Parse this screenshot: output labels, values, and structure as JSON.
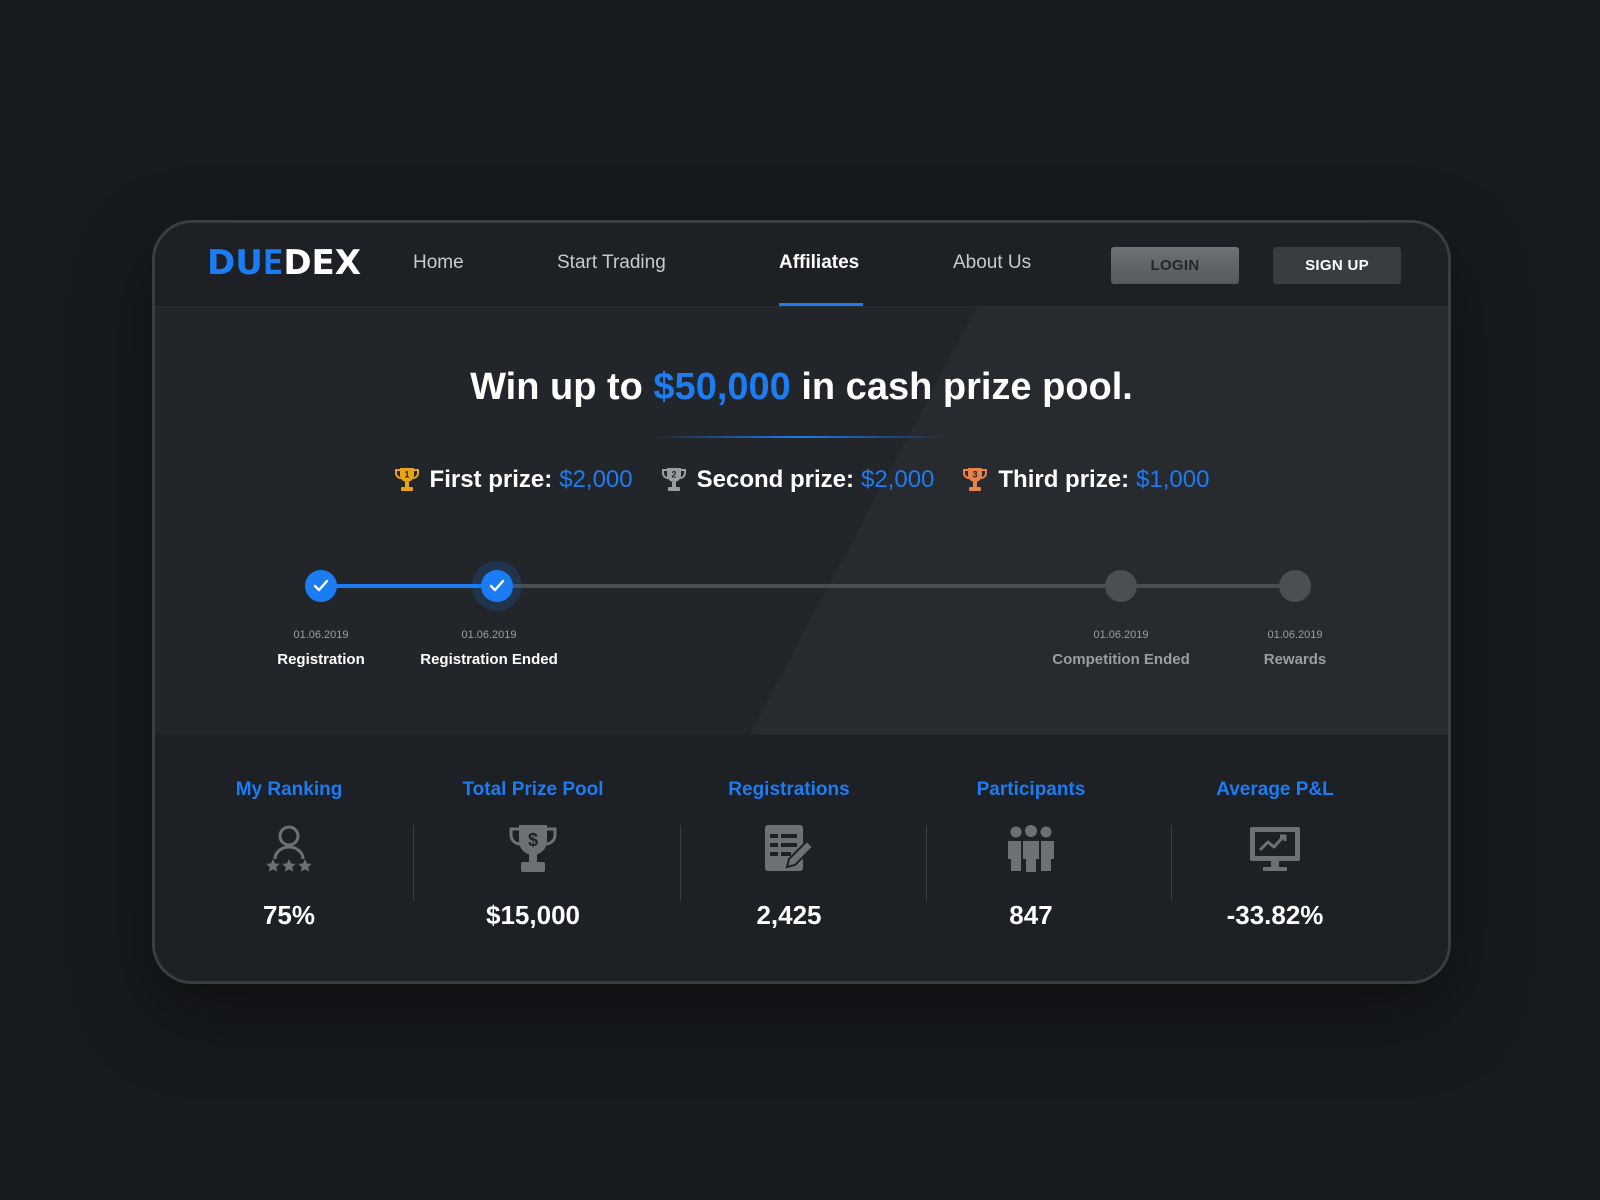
{
  "brand": {
    "logo_part1": "DU",
    "logo_part2": "E",
    "logo_part3": "DEX"
  },
  "nav": {
    "items": [
      {
        "label": "Home"
      },
      {
        "label": "Start Trading"
      },
      {
        "label": "Affiliates",
        "active": true
      },
      {
        "label": "About Us"
      }
    ],
    "login_label": "LOGIN",
    "signup_label": "SIGN UP"
  },
  "hero": {
    "headline_pre": "Win up to",
    "headline_amount": "$50,000",
    "headline_post": "in cash prize pool.",
    "prizes": [
      {
        "label": "First prize:",
        "value": "$2,000",
        "rank": "1",
        "color": "#e8a317"
      },
      {
        "label": "Second prize:",
        "value": "$2,000",
        "rank": "2",
        "color": "#9a9da1"
      },
      {
        "label": "Third prize:",
        "value": "$1,000",
        "rank": "3",
        "color": "#e8834a"
      }
    ]
  },
  "timeline": {
    "steps": [
      {
        "date": "01.06.2019",
        "label": "Registration",
        "done": true
      },
      {
        "date": "01.06.2019",
        "label": "Registration Ended",
        "done": true
      },
      {
        "date": "01.06.2019",
        "label": "Competition Ended",
        "done": false
      },
      {
        "date": "01.06.2019",
        "label": "Rewards",
        "done": false
      }
    ]
  },
  "stats": [
    {
      "title": "My Ranking",
      "value": "75%",
      "icon": "ranking-icon"
    },
    {
      "title": "Total Prize Pool",
      "value": "$15,000",
      "icon": "trophy-dollar-icon"
    },
    {
      "title": "Registrations",
      "value": "2,425",
      "icon": "registration-form-icon"
    },
    {
      "title": "Participants",
      "value": "847",
      "icon": "participants-icon"
    },
    {
      "title": "Average P&L",
      "value": "-33.82%",
      "icon": "monitor-chart-icon"
    }
  ],
  "colors": {
    "accent": "#1c7cf4",
    "background": "#181b1e",
    "panel": "#1d2024",
    "hero": "#222529"
  }
}
